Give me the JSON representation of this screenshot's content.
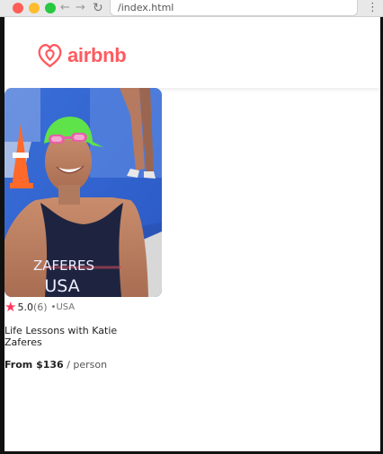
{
  "browser": {
    "url": "/index.html",
    "back_icon": "arrow-left-icon",
    "forward_icon": "arrow-right-icon",
    "reload_icon": "reload-icon",
    "menu_icon": "kebab-menu-icon"
  },
  "header": {
    "logo_text": "airbnb",
    "brand_color": "#ff5a5f"
  },
  "card": {
    "rating": "5.0",
    "review_count": "(6)",
    "location": "•USA",
    "title": "Life Lessons with Katie Zaferes",
    "price_prefix": "From $136",
    "price_suffix": " / person",
    "photo_text": [
      "ZAFERES",
      "USA"
    ],
    "star_color": "#ff385c"
  }
}
